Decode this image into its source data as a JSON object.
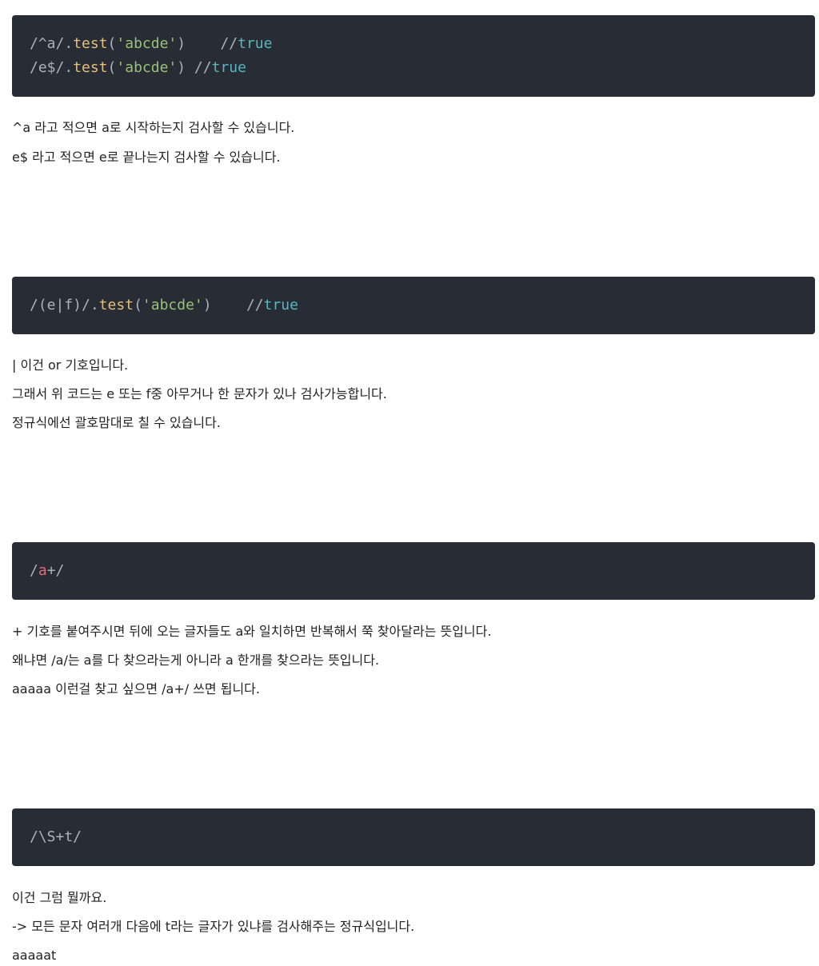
{
  "blocks": [
    {
      "code": [
        {
          "slash_open": "/^a/.",
          "method": "test",
          "paren_open": "(",
          "string": "'abcde'",
          "paren_close": ")    //",
          "bool": "true"
        },
        {
          "slash_open": "/e$/.",
          "method": "test",
          "paren_open": "(",
          "string": "'abcde'",
          "paren_close": ") //",
          "bool": "true"
        }
      ],
      "paragraphs": [
        "^a 라고 적으면 a로 시작하는지 검사할 수 있습니다.",
        "e$ 라고 적으면 e로 끝나는지 검사할 수 있습니다."
      ]
    },
    {
      "code": [
        {
          "slash_open": "/(e|f)/.",
          "method": "test",
          "paren_open": "(",
          "string": "'abcde'",
          "paren_close": ")    //",
          "bool": "true"
        }
      ],
      "paragraphs": [
        "| 이건 or 기호입니다.",
        "그래서 위 코드는 e 또는 f중 아무거나 한 문자가 있나 검사가능합니다.",
        "정규식에선 괄호맘대로 칠 수 있습니다."
      ]
    },
    {
      "code": [
        {
          "open": "/",
          "highlight": "a",
          "close": "+/"
        }
      ],
      "paragraphs": [
        "+ 기호를 붙여주시면 뒤에 오는 글자들도 a와 일치하면 반복해서 쭉 찾아달라는 뜻입니다.",
        "왜냐면 /a/는 a를 다 찾으라는게 아니라 a 한개를 찾으라는 뜻입니다.",
        "aaaaa 이런걸 찾고 싶으면 /a+/ 쓰면 됩니다."
      ]
    },
    {
      "code": [
        {
          "text": "/\\S+t/"
        }
      ],
      "paragraphs": [
        "이건 그럼 뭘까요.",
        "-> 모든 문자 여러개 다음에 t라는 글자가 있냐를 검사해주는 정규식입니다.",
        "aaaaat"
      ]
    }
  ],
  "colors": {
    "code_background": "#282c34",
    "code_text": "#abb2bf",
    "method": "#e5c07b",
    "string": "#98c379",
    "boolean": "#56b6c2",
    "highlight": "#e06c75"
  }
}
